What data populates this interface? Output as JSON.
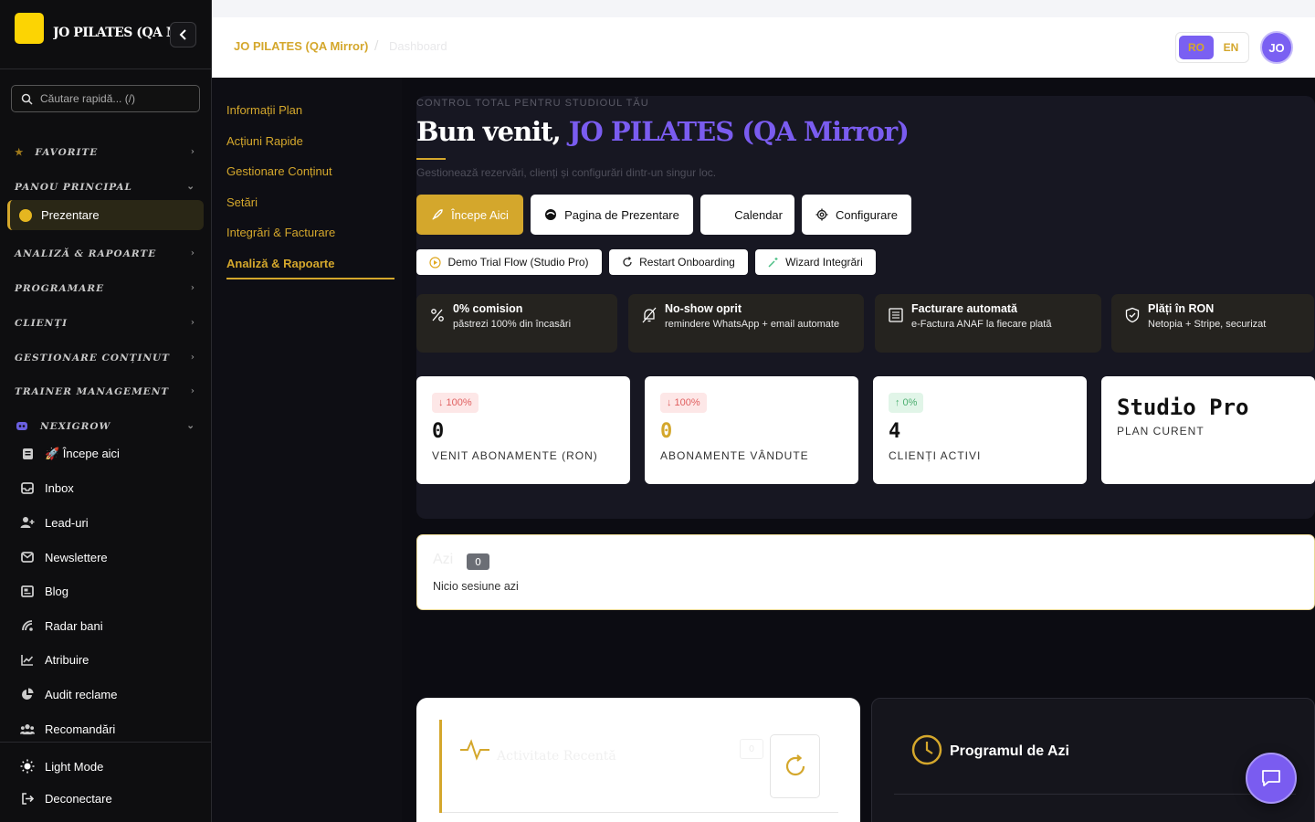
{
  "sidebar": {
    "brand": "JO PILATES (QA Mirror)",
    "search_placeholder": "Căutare rapidă... (/)",
    "sections": {
      "favorite": "FAVORITE",
      "panou": "PANOU PRINCIPAL",
      "analiza": "ANALIZĂ & RAPOARTE",
      "programare": "PROGRAMARE",
      "clienti": "CLIENȚI",
      "continut": "GESTIONARE CONȚINUT",
      "trainer": "TRAINER MANAGEMENT",
      "nexigrow": "NEXIGROW"
    },
    "active_item": "Prezentare",
    "items": [
      {
        "label": "🚀 Începe aici",
        "icon": "book-icon"
      },
      {
        "label": "Inbox",
        "icon": "inbox-icon"
      },
      {
        "label": "Lead-uri",
        "icon": "user-plus-icon"
      },
      {
        "label": "Newslettere",
        "icon": "mail-stack-icon"
      },
      {
        "label": "Blog",
        "icon": "newspaper-icon"
      },
      {
        "label": "Radar bani",
        "icon": "radar-icon"
      },
      {
        "label": "Atribuire",
        "icon": "trend-chart-icon"
      },
      {
        "label": "Audit reclame",
        "icon": "pie-chart-icon"
      },
      {
        "label": "Recomandări",
        "icon": "users-icon"
      }
    ],
    "footer": {
      "light_mode": "Light Mode",
      "logout": "Deconectare"
    }
  },
  "topbar": {
    "crumb_studio": "JO PILATES (QA Mirror)",
    "crumb_sep": "/",
    "crumb_page": "Dashboard",
    "lang_ro": "RO",
    "lang_en": "EN",
    "avatar": "JO"
  },
  "subnav": {
    "items": [
      "Informații Plan",
      "Acțiuni Rapide",
      "Gestionare Conținut",
      "Setări",
      "Integrări & Facturare",
      "Analiză & Rapoarte"
    ]
  },
  "hero": {
    "eyebrow": "CONTROL TOTAL PENTRU STUDIOUL TĂU",
    "welcome": "Bun venit,",
    "studio": "JO PILATES (QA Mirror)",
    "subtitle": "Gestionează rezervări, clienți și configurări dintr-un singur loc.",
    "buttons": {
      "start": "Începe Aici",
      "presentation": "Pagina de Prezentare",
      "calendar": "Calendar",
      "config": "Configurare"
    },
    "small_buttons": {
      "demo": "Demo Trial Flow (Studio Pro)",
      "restart": "Restart Onboarding",
      "wizard": "Wizard Integrări"
    },
    "features": [
      {
        "title": "0% comision",
        "desc": "păstrezi 100% din încasări"
      },
      {
        "title": "No-show oprit",
        "desc": "remindere WhatsApp + email automate"
      },
      {
        "title": "Facturare automată",
        "desc": "e-Factura ANAF la fiecare plată"
      },
      {
        "title": "Plăți în RON",
        "desc": "Netopia + Stripe, securizat"
      }
    ],
    "stats": [
      {
        "badge": "↓ 100%",
        "value": "0",
        "label": "VENIT ABONAMENTE (RON)"
      },
      {
        "badge": "↓ 100%",
        "value": "0",
        "label": "ABONAMENTE VÂNDUTE"
      },
      {
        "badge": "↑ 0%",
        "value": "4",
        "label": "CLIENȚI ACTIVI"
      }
    ],
    "plan": {
      "name": "Studio Pro",
      "label": "PLAN CURENT"
    }
  },
  "today": {
    "title": "Azi",
    "count": "0",
    "empty": "Nicio sesiune azi"
  },
  "activity": {
    "title": "Activitate Recentă",
    "count": "0"
  },
  "schedule": {
    "title": "Programul de Azi"
  },
  "colors": {
    "accent": "#d4a72c",
    "brand_purple": "#7a5cf0",
    "sidebar_bg": "#0e0e10"
  }
}
